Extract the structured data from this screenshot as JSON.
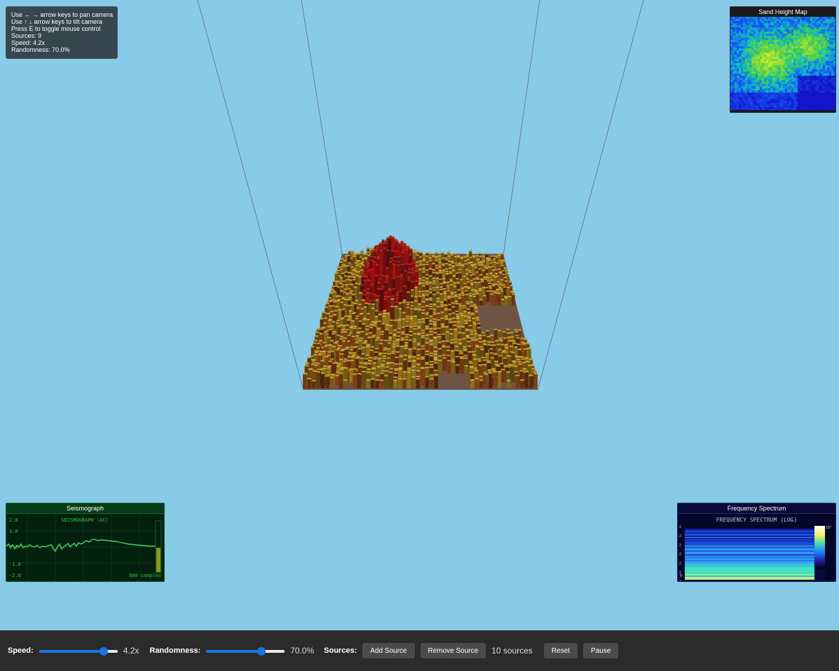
{
  "info": {
    "line_pan": "Use ← → arrow keys to pan camera",
    "line_tilt": "Use ↑ ↓ arrow keys to tilt camera",
    "line_mouse": "Press E to toggle mouse control",
    "line_sources": "Sources: 9",
    "line_speed": "Speed: 4.2x",
    "line_randomness": "Randomness: 70.0%"
  },
  "heatmap": {
    "title": "Sand Height Map"
  },
  "seismograph": {
    "title": "Seismograph",
    "header": "SEISMOGRAPH (AC)",
    "y_labels": [
      "2.0",
      "1.0",
      "0.0",
      "-1.0",
      "-2.0"
    ],
    "samples_label": "300 samples",
    "level_fraction": 0.48
  },
  "spectrum": {
    "title": "Frequency Spectrum",
    "header": "FREQUENCY SPECTRUM (LOG)",
    "axis_chars": [
      "z",
      "z",
      "z",
      "z",
      "z",
      "z",
      "z"
    ],
    "origin_label": "0",
    "colorbar_label": "10^"
  },
  "toolbar": {
    "speed_label": "Speed:",
    "speed_value": "4.2x",
    "speed_fraction": 0.82,
    "randomness_label": "Randomness:",
    "randomness_value": "70.0%",
    "randomness_fraction": 0.7,
    "sources_label": "Sources:",
    "add_source": "Add Source",
    "remove_source": "Remove Source",
    "sources_count": "10 sources",
    "reset": "Reset",
    "pause": "Pause"
  },
  "colors": {
    "sky": "#87cbe8",
    "ground": "#6e5444",
    "sand_red": "#8a1010",
    "sand_yellow": "#a8901c",
    "accent": "#1a73e8"
  }
}
